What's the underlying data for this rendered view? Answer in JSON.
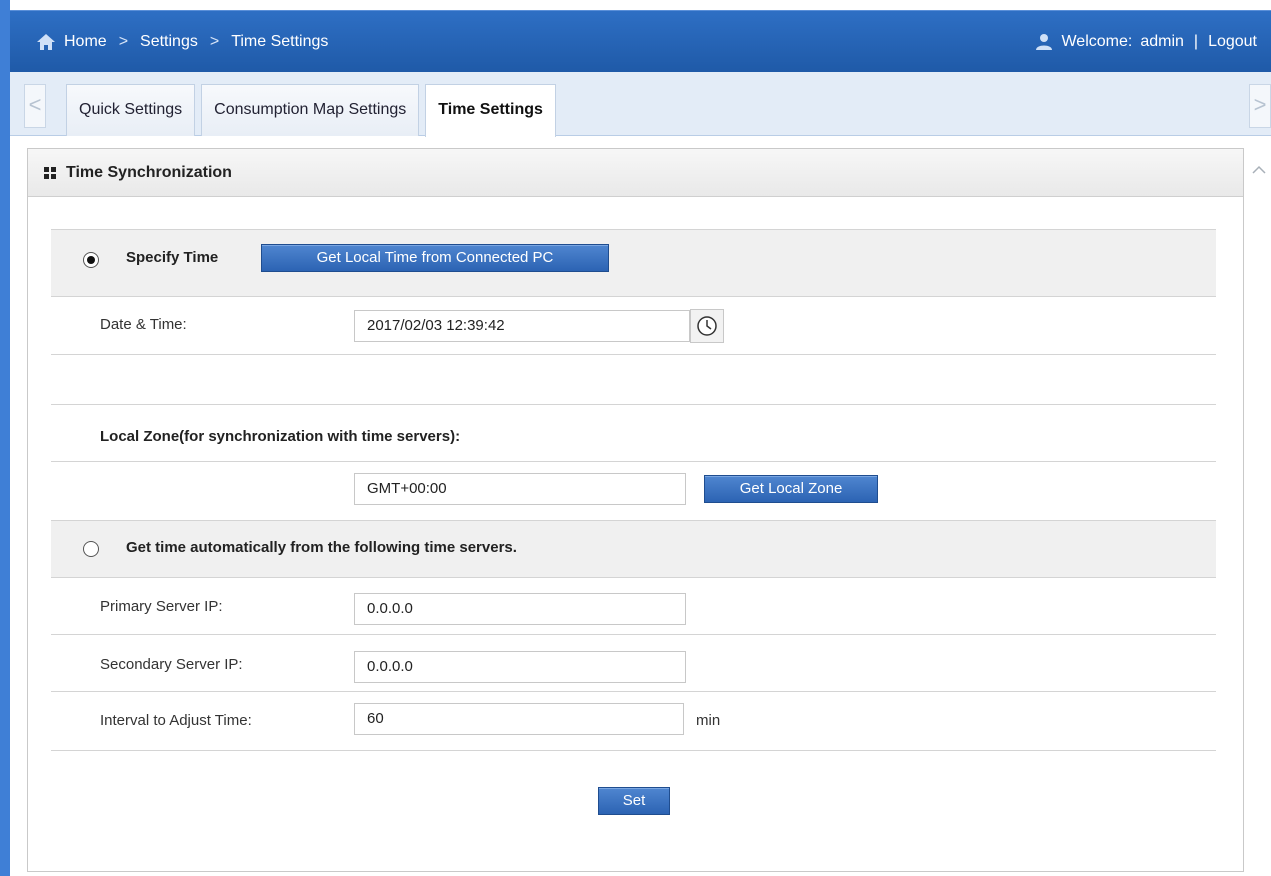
{
  "breadcrumb": {
    "home": "Home",
    "settings": "Settings",
    "current": "Time Settings",
    "separator": ">"
  },
  "user": {
    "welcome_label": "Welcome:",
    "username": "admin",
    "separator": "|",
    "logout": "Logout"
  },
  "tabs": [
    {
      "label": "Quick Settings"
    },
    {
      "label": "Consumption Map Settings"
    },
    {
      "label": "Time Settings"
    }
  ],
  "tab_arrows": {
    "left": "<",
    "right": ">"
  },
  "panel": {
    "title": "Time Synchronization"
  },
  "specify_time": {
    "label": "Specify Time",
    "get_local_time_button": "Get Local Time from Connected PC",
    "date_time_label": "Date & Time:",
    "date_time_value": "2017/02/03 12:39:42"
  },
  "local_zone": {
    "label": "Local Zone(for synchronization with time servers):",
    "value": "GMT+00:00",
    "button": "Get Local Zone"
  },
  "auto_time": {
    "label": "Get time automatically from the following time servers.",
    "primary_label": "Primary Server IP:",
    "primary_value": "0.0.0.0",
    "secondary_label": "Secondary Server IP:",
    "secondary_value": "0.0.0.0",
    "interval_label": "Interval to Adjust Time:",
    "interval_value": "60",
    "interval_unit": "min"
  },
  "set_button": "Set",
  "colors": {
    "nav": "#2e6fc4",
    "button": "#3a70bf",
    "tab_bg": "#e3ecf7"
  }
}
